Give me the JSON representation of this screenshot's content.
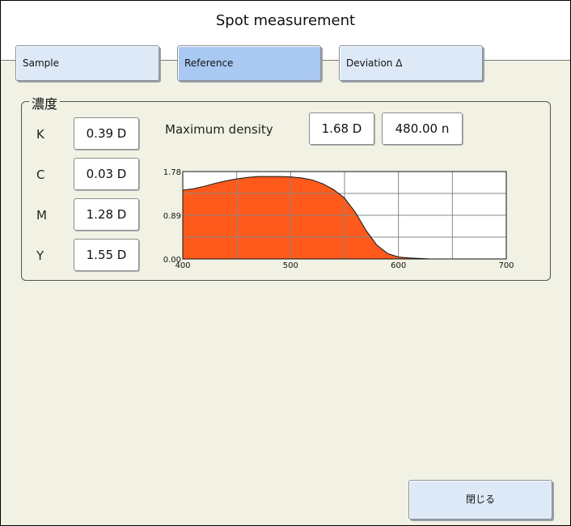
{
  "window": {
    "title": "Spot measurement"
  },
  "tabs": [
    {
      "label": "Sample",
      "active": false
    },
    {
      "label": "Reference",
      "active": true
    },
    {
      "label": "Deviation Δ",
      "active": false
    }
  ],
  "density": {
    "group_title": "濃度",
    "channels": [
      {
        "label": "K",
        "value": "0.39 D"
      },
      {
        "label": "C",
        "value": "0.03 D"
      },
      {
        "label": "M",
        "value": "1.28 D"
      },
      {
        "label": "Y",
        "value": "1.55 D"
      }
    ],
    "maximum_density": {
      "label": "Maximum density",
      "value": "1.68 D",
      "wavelength": "480.00 n"
    }
  },
  "chart_data": {
    "type": "area",
    "x": [
      400,
      410,
      420,
      430,
      440,
      450,
      460,
      470,
      480,
      490,
      500,
      510,
      520,
      530,
      540,
      550,
      560,
      570,
      580,
      590,
      600,
      610,
      620,
      630,
      640,
      650,
      660,
      670,
      680,
      690,
      700
    ],
    "y": [
      1.4,
      1.43,
      1.48,
      1.54,
      1.59,
      1.63,
      1.66,
      1.68,
      1.68,
      1.68,
      1.67,
      1.65,
      1.61,
      1.53,
      1.41,
      1.24,
      0.95,
      0.58,
      0.28,
      0.11,
      0.04,
      0.02,
      0.01,
      0.0,
      0.0,
      0.0,
      0.0,
      0.0,
      0.0,
      0.0,
      0.0
    ],
    "xlim": [
      400,
      700
    ],
    "ylim": [
      0,
      1.78
    ],
    "xticks": [
      "400",
      "500",
      "600",
      "700"
    ],
    "yticks": [
      "0.00",
      "0.89",
      "1.78"
    ],
    "grid": true,
    "fill_color": "#ff5a1c",
    "grid_color": "#888888"
  },
  "close_button": {
    "label": "閉じる"
  }
}
